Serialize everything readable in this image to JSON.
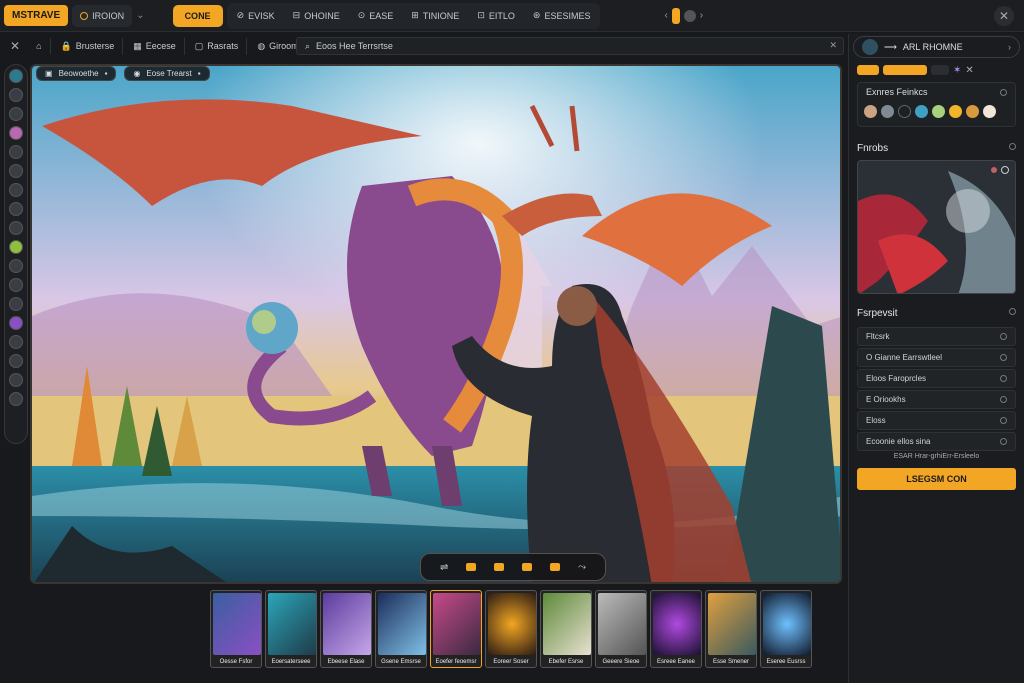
{
  "topbar": {
    "brand": "MSTRAVE",
    "tab1": "IROION",
    "active_tab": "CONE",
    "tabs": [
      "EVISK",
      "OHOINE",
      "EASE",
      "TINIONE",
      "EITLO",
      "ESESIMES"
    ],
    "close_glyph": "✕"
  },
  "toolbar2": {
    "items": [
      "Brusterse",
      "Eecese",
      "Rasrats",
      "Girooms"
    ],
    "search_text": "Eoos Hee Terrsrtse"
  },
  "canvas_tabs": {
    "tab1": "Beowoethe",
    "tab2": "Eose Trearst"
  },
  "right_panel": {
    "search_text": "ARL RHOMNE",
    "section1_title": "Exnres Feinkcs",
    "swatch_colors": [
      "#c9a384",
      "#7e8b95",
      "#1d1f22",
      "#3fa0c4",
      "#a7d07f",
      "#f1b52a",
      "#d99a3d",
      "#f0e6d8"
    ],
    "preview_title": "Fnrobs",
    "list_title": "Fsrpevsit",
    "list_items": [
      "Fltcsrk",
      "O Gianne Earrswtleel",
      "Eloos Faroprcles",
      "E Oriookhs",
      "Eloss",
      "Ecoonie ellos sina"
    ],
    "list_note": "ESAR Hrar-grhiErr-Ersleelo",
    "cta_label": "LSEGSM CON"
  },
  "thumbnails": [
    "Oesse Fsfor",
    "Eoersaterseee",
    "Ebeese Elase",
    "Gsene Emsrse",
    "Eoefer feoemsr",
    "Eoreer Soser",
    "Ebefer Esrse",
    "Geeere Sieoe",
    "Esreee Eanee",
    "Esse Smener",
    "Eseree Eusrss"
  ],
  "colors": {
    "accent": "#f3a623",
    "background": "#17191c"
  }
}
